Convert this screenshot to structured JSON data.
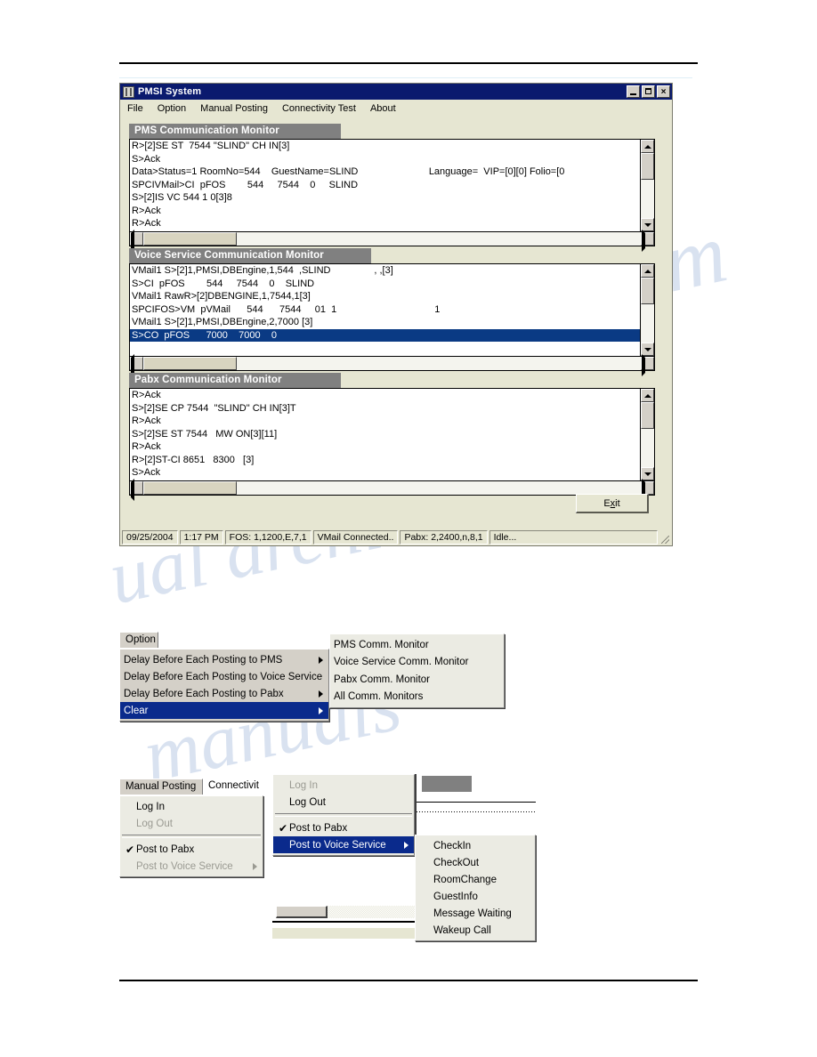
{
  "window": {
    "title": "PMSI System",
    "icon": "application-icon",
    "controls": {
      "minimize": "minimize-icon",
      "maximize": "maximize-icon",
      "close": "close-icon"
    },
    "menubar": [
      "File",
      "Option",
      "Manual Posting",
      "Connectivity Test",
      "About"
    ],
    "exit_button": {
      "before": "E",
      "accel": "x",
      "after": "it"
    }
  },
  "monitors": [
    {
      "title": "PMS Communication Monitor",
      "lines": [
        {
          "text": "R>[2]SE ST  7544 \"SLIND\" CH IN[3]",
          "selected": false
        },
        {
          "text": "S>Ack",
          "selected": false
        },
        {
          "text": "Data>Status=1 RoomNo=544    GuestName=SLIND                          Language=  VIP=[0][0] Folio=[0",
          "selected": false
        },
        {
          "text": "SPCIVMail>CI  pFOS        544     7544    0     SLIND",
          "selected": false
        },
        {
          "text": "S>[2]IS VC 544 1 0[3]8",
          "selected": false
        },
        {
          "text": "R>Ack",
          "selected": false
        },
        {
          "text": "R>Ack",
          "selected": false
        }
      ]
    },
    {
      "title": "Voice Service Communication Monitor",
      "lines": [
        {
          "text": "VMail1 S>[2]1,PMSI,DBEngine,1,544  ,SLIND                , ,[3]",
          "selected": false
        },
        {
          "text": "S>CI  pFOS        544     7544    0    SLIND",
          "selected": false
        },
        {
          "text": "VMail1 RawR>[2]DBENGINE,1,7544,1[3]",
          "selected": false
        },
        {
          "text": "SPCIFOS>VM  pVMail      544      7544     01  1                                    1",
          "selected": false
        },
        {
          "text": "VMail1 S>[2]1,PMSI,DBEngine,2,7000 [3]",
          "selected": false
        },
        {
          "text": "S>CO  pFOS      7000    7000    0",
          "selected": true
        }
      ]
    },
    {
      "title": "Pabx Communication Monitor",
      "lines": [
        {
          "text": "R>Ack",
          "selected": false
        },
        {
          "text": "S>[2]SE CP 7544  \"SLIND\" CH IN[3]T",
          "selected": false
        },
        {
          "text": "R>Ack",
          "selected": false
        },
        {
          "text": "S>[2]SE ST 7544   MW ON[3][11]",
          "selected": false
        },
        {
          "text": "R>Ack",
          "selected": false
        },
        {
          "text": "R>[2]ST-CI 8651   8300   [3]",
          "selected": false
        },
        {
          "text": "S>Ack",
          "selected": false
        }
      ]
    }
  ],
  "statusbar": {
    "date": "09/25/2004",
    "time": "1:17 PM",
    "fos": "FOS: 1,1200,E,7,1",
    "vmail": "VMail Connected..",
    "pabx": "Pabx: 2,2400,n,8,1",
    "state": "Idle..."
  },
  "option_figure": {
    "tab_label": "Option",
    "items": [
      {
        "label": "Delay Before Each Posting to PMS",
        "submenu": true,
        "highlight": false
      },
      {
        "label": "Delay Before Each Posting to Voice Service",
        "submenu": true,
        "highlight": false
      },
      {
        "label": "Delay Before Each Posting to Pabx",
        "submenu": true,
        "highlight": false
      },
      {
        "label": "Clear",
        "submenu": true,
        "highlight": true
      }
    ],
    "submenu": [
      "PMS Comm. Monitor",
      "Voice Service Comm. Monitor",
      "Pabx Comm. Monitor",
      "All Comm. Monitors"
    ]
  },
  "posting_figure": {
    "tab_label": "Manual Posting",
    "neighbor_tab_label": "Connectivit",
    "left_menu": [
      {
        "label": "Log In",
        "disabled": false,
        "checked": false,
        "submenu": false,
        "highlight": false
      },
      {
        "label": "Log Out",
        "disabled": true,
        "checked": false,
        "submenu": false,
        "highlight": false
      },
      {
        "separator": true
      },
      {
        "label": "Post to Pabx",
        "disabled": false,
        "checked": true,
        "submenu": false,
        "highlight": false
      },
      {
        "label": "Post to Voice Service",
        "disabled": true,
        "checked": false,
        "submenu": true,
        "highlight": false
      }
    ],
    "middle_menu": [
      {
        "label": "Log In",
        "disabled": true,
        "checked": false,
        "submenu": false,
        "highlight": false
      },
      {
        "label": "Log Out",
        "disabled": false,
        "checked": false,
        "submenu": false,
        "highlight": false
      },
      {
        "separator": true
      },
      {
        "label": "Post to Pabx",
        "disabled": false,
        "checked": true,
        "submenu": false,
        "highlight": false
      },
      {
        "label": "Post to Voice Service",
        "disabled": false,
        "checked": false,
        "submenu": true,
        "highlight": true
      }
    ],
    "submenu": [
      "CheckIn",
      "CheckOut",
      "RoomChange",
      "GuestInfo",
      "Message Waiting",
      "Wakeup Call"
    ]
  },
  "colors": {
    "titlebar": "#0a1a6e",
    "window_face": "#e6e6d2",
    "group_header": "#808080",
    "selection": "#0a3a84",
    "menu_highlight": "#0a2a8c"
  }
}
